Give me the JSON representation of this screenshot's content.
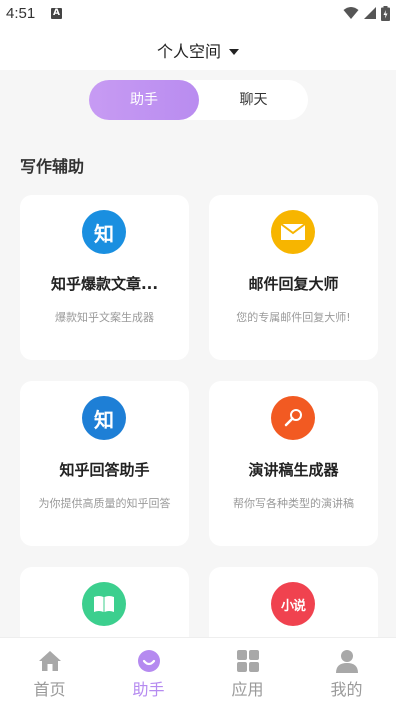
{
  "status": {
    "time": "4:51",
    "badge": "A"
  },
  "header": {
    "title": "个人空间"
  },
  "tabs": [
    {
      "label": "助手",
      "active": true
    },
    {
      "label": "聊天",
      "active": false
    }
  ],
  "section": {
    "title": "写作辅助"
  },
  "cards": [
    {
      "title": "知乎爆款文章...",
      "desc": "爆款知乎文案生成器",
      "icon": "zhihu-icon",
      "icon_text": "知",
      "color": "#1a8fe0"
    },
    {
      "title": "邮件回复大师",
      "desc": "您的专属邮件回复大师!",
      "icon": "envelope-icon",
      "color": "#f7b500"
    },
    {
      "title": "知乎回答助手",
      "desc": "为你提供高质量的知乎回答",
      "icon": "zhihu-icon",
      "icon_text": "知",
      "color": "#1e7fd6"
    },
    {
      "title": "演讲稿生成器",
      "desc": "帮你写各种类型的演讲稿",
      "icon": "microphone-icon",
      "color": "#f25a22"
    },
    {
      "title": "",
      "desc": "",
      "icon": "book-icon",
      "color": "#3ccf8e"
    },
    {
      "title": "",
      "desc": "",
      "icon": "novel-icon",
      "icon_text": "小说",
      "color": "#f0424f"
    }
  ],
  "nav": [
    {
      "label": "首页",
      "icon": "home-icon",
      "active": false
    },
    {
      "label": "助手",
      "icon": "assistant-icon",
      "active": true
    },
    {
      "label": "应用",
      "icon": "apps-grid-icon",
      "active": false
    },
    {
      "label": "我的",
      "icon": "profile-icon",
      "active": false
    }
  ],
  "colors": {
    "accent": "#b58af0",
    "inactive": "#9a9a9a"
  }
}
